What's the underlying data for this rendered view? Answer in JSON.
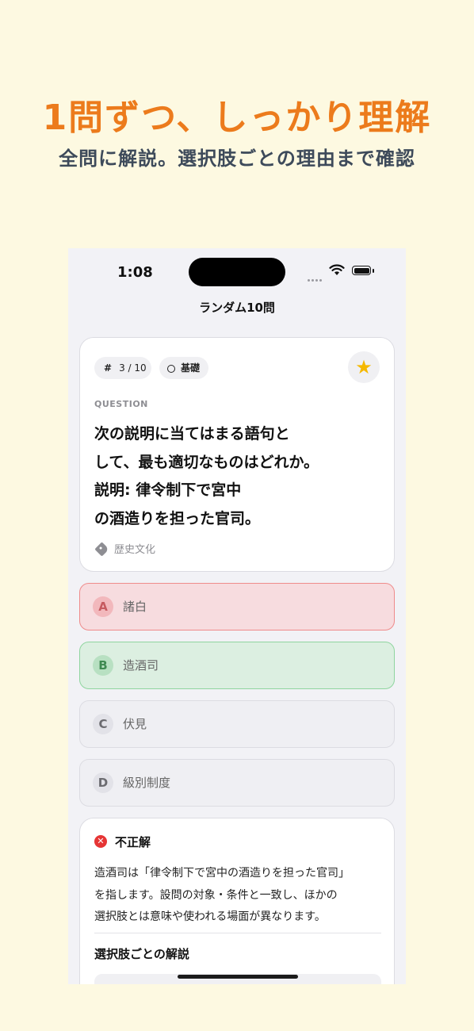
{
  "promo": {
    "headline": "1問ずつ、しっかり理解",
    "subheadline": "全問に解説。選択肢ごとの理由まで確認"
  },
  "status_bar": {
    "time": "1:08"
  },
  "nav": {
    "title": "ランダム10問"
  },
  "question_card": {
    "number_chip": "3 / 10",
    "level_chip": "基礎",
    "favorite": true,
    "label": "QUESTION",
    "lines": [
      "次の説明に当てはまる語句と",
      "して、最も適切なものはどれか。",
      "説明: 律令制下で宮中",
      "の酒造りを担った官司。"
    ],
    "tag": "歴史文化"
  },
  "options": [
    {
      "letter": "A",
      "text": "諸白",
      "state": "wrong"
    },
    {
      "letter": "B",
      "text": "造酒司",
      "state": "correct"
    },
    {
      "letter": "C",
      "text": "伏見",
      "state": "neutral"
    },
    {
      "letter": "D",
      "text": "級別制度",
      "state": "neutral"
    }
  ],
  "explanation": {
    "result": "不正解",
    "lines": [
      "造酒司は「律令制下で宮中の酒造りを担った官司」",
      "を指します。設問の対象・条件と一致し、ほかの",
      "選択肢とは意味や使われる場面が異なります。"
    ],
    "per_option_heading": "選択肢ごとの解説"
  },
  "colors": {
    "background": "#fdf9e1",
    "headline": "#ec7b1c",
    "subheadline": "#3d4a5a",
    "wrong": "#ef8b8b",
    "correct": "#8fd59f",
    "star": "#f5b800",
    "error_icon": "#e63535"
  }
}
